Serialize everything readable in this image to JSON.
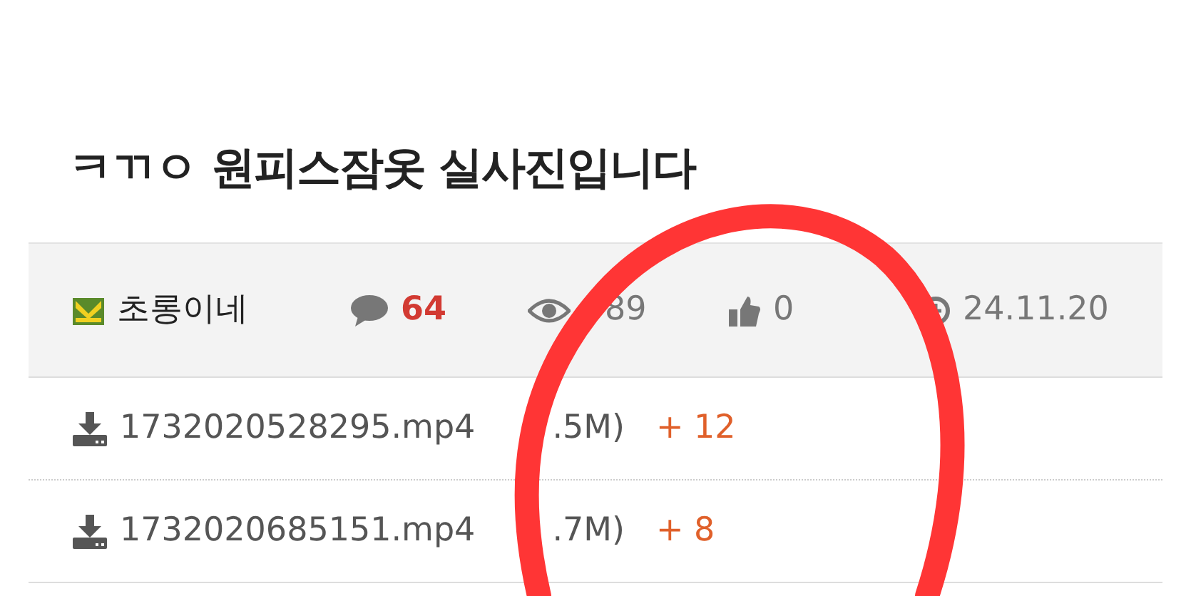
{
  "post": {
    "title": "ㅋㄲㅇ 원피스잠옷 실사진입니다"
  },
  "meta": {
    "author": "초롱이네",
    "comments": "64",
    "views": "89",
    "likes": "0",
    "date": "24.11.20"
  },
  "attachments": [
    {
      "filename": "1732020528295.mp4",
      "size": ".5M)",
      "downloads": "+ 12"
    },
    {
      "filename": "1732020685151.mp4",
      "size": ".7M)",
      "downloads": "+ 8"
    }
  ]
}
